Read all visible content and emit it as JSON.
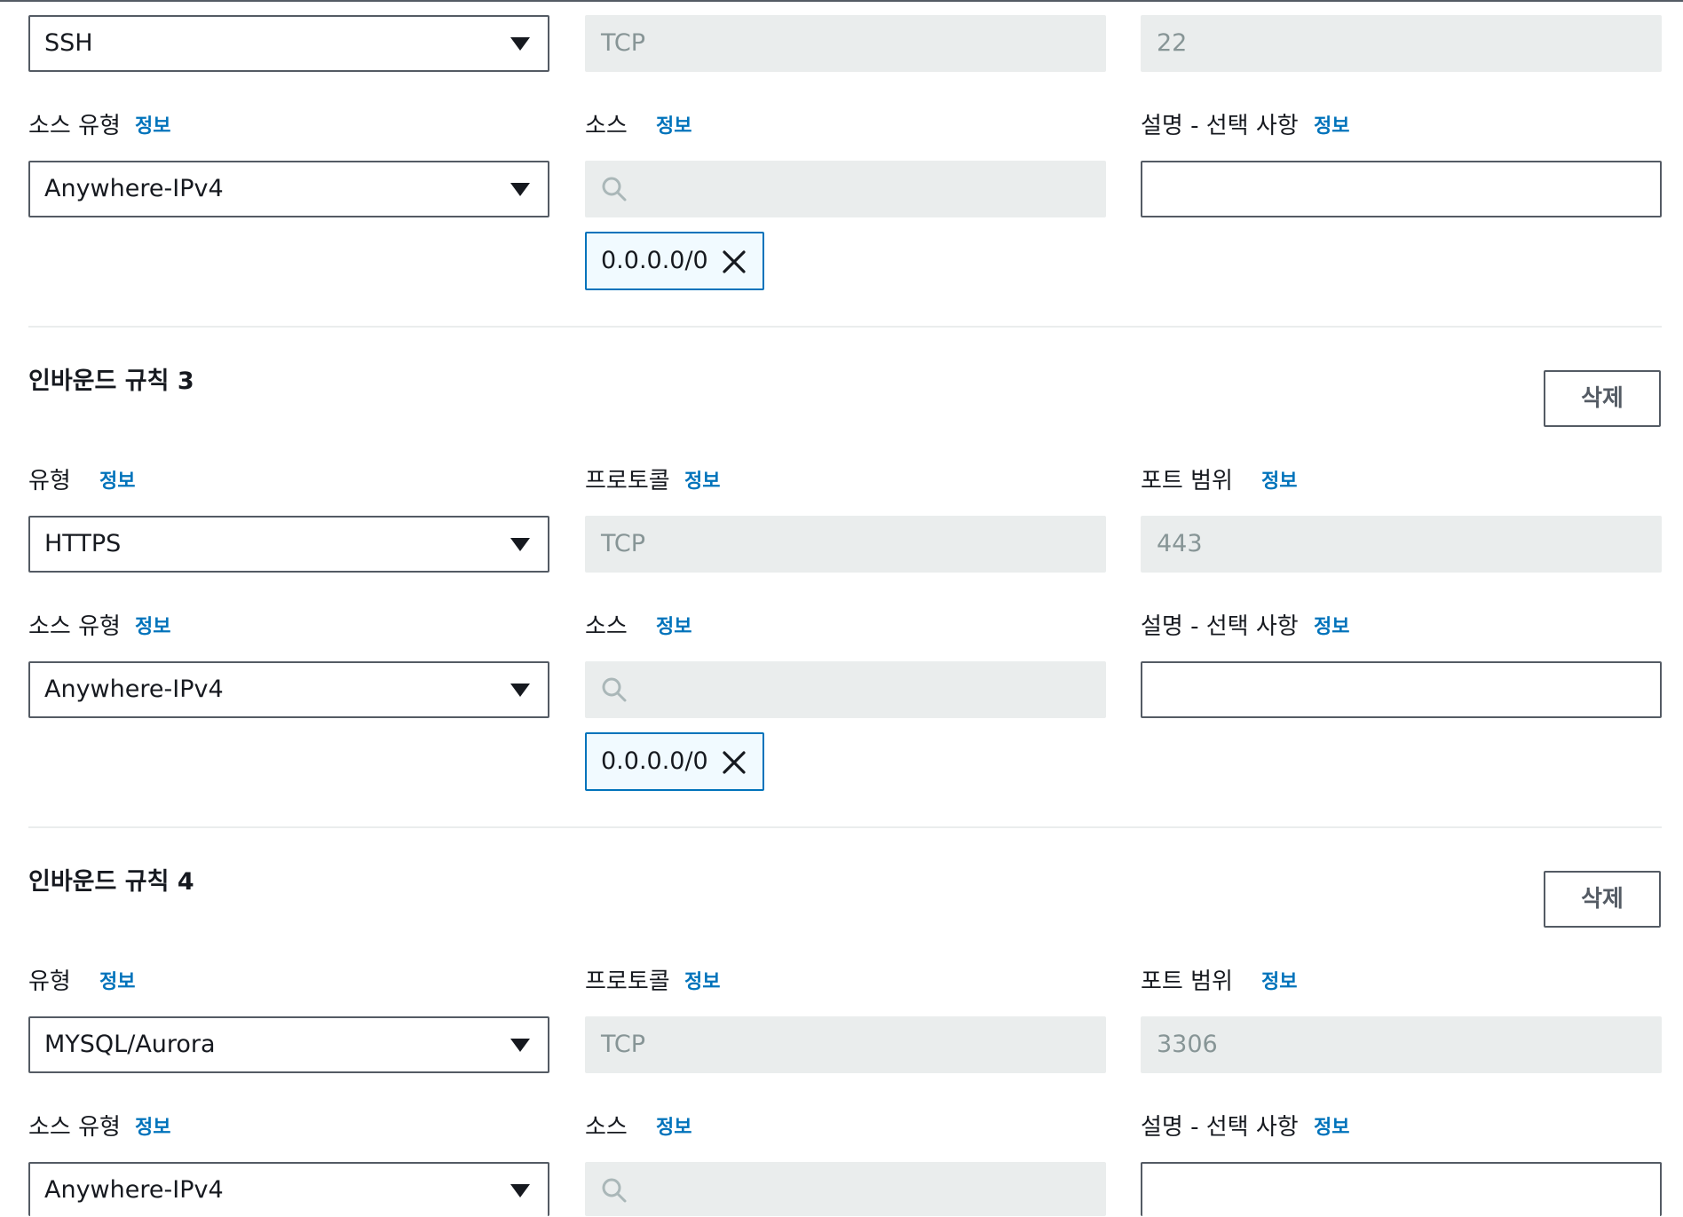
{
  "info_label": "정보",
  "remove_label": "삭제",
  "field_labels": {
    "type": "유형",
    "protocol": "프로토콜",
    "port_range": "포트 범위",
    "source_type": "소스 유형",
    "source": "소스",
    "description": "설명 - 선택 사항"
  },
  "rules": [
    {
      "type": "SSH",
      "protocol": "TCP",
      "port": "22",
      "source_type": "Anywhere-IPv4",
      "source_token": "0.0.0.0/0",
      "description": ""
    },
    {
      "heading": "인바운드 규칙 3",
      "type": "HTTPS",
      "protocol": "TCP",
      "port": "443",
      "source_type": "Anywhere-IPv4",
      "source_token": "0.0.0.0/0",
      "description": ""
    },
    {
      "heading": "인바운드 규칙 4",
      "type": "MYSQL/Aurora",
      "protocol": "TCP",
      "port": "3306",
      "source_type": "Anywhere-IPv4",
      "description": ""
    }
  ],
  "colors": {
    "link": "#0073bb",
    "token_bg": "#f1faff",
    "disabled_bg": "#eaeded",
    "border": "#545b64"
  }
}
